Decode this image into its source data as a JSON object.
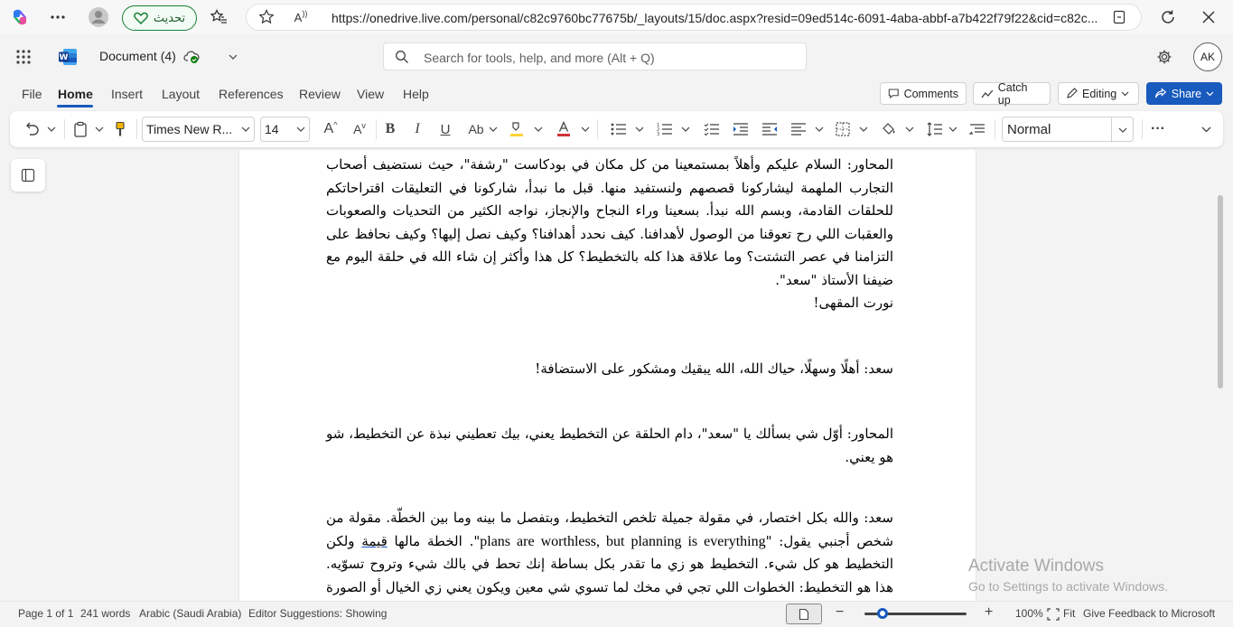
{
  "browser": {
    "update_button": "تحديث",
    "reader_label": "A",
    "url": "https://onedrive.live.com/personal/c82c9760bc77675b/_layouts/15/doc.aspx?resid=09ed514c-6091-4aba-abbf-a7b422f79f22&cid=c82c..."
  },
  "title_bar": {
    "doc_name": "Document (4)",
    "search_placeholder": "Search for tools, help, and more (Alt + Q)",
    "user_initials": "AK"
  },
  "tabs": [
    "File",
    "Home",
    "Insert",
    "Layout",
    "References",
    "Review",
    "View",
    "Help"
  ],
  "active_tab": "Home",
  "actions": {
    "comments": "Comments",
    "catch_up": "Catch up",
    "editing": "Editing",
    "share": "Share"
  },
  "ribbon": {
    "font_name": "Times New R...",
    "font_size": "14",
    "style": "Normal",
    "more": "···",
    "font_color": "#d13438",
    "highlight_color": "#ffd335"
  },
  "document": {
    "paragraphs": [
      "المحاور: السلام عليكم وأهلاً بمستمعينا من كل مكان في بودكاست \"رشفة\"، حيث نستضيف أصحاب التجارب الملهمة ليشاركونا قصصهم ولنستفيد منها. قبل ما نبدأ، شاركونا في التعليقات اقتراحاتكم للحلقات القادمة، وبسم الله نبدأ. بسعينا وراء النجاح والإنجاز، نواجه الكثير من التحديات والصعوبات والعقبات اللي رح تعوقنا من الوصول لأهدافنا. كيف نحدد أهدافنا؟ وكيف نصل إليها؟ وكيف نحافظ على التزامنا في عصر التشتت؟ وما علاقة هذا كله بالتخطيط؟ كل هذا وأكثر إن شاء الله في حلقة اليوم مع ضيفنا الأستاذ \"سعد\".",
      "نورت المقهى!",
      "سعد: أهلًا وسهلًا، حياك الله، الله يبقيك ومشكور على الاستضافة!",
      "المحاور: أوّل شي بسألك يا \"سعد\"، دام الحلقة عن التخطيط يعني، بيك تعطيني نبذة عن التخطيط، شو هو يعني."
    ],
    "p5_intro": "سعد: والله بكل اختصار، في مقولة جميلة تلخص التخطيط، وبتفصل ما بينه وما بين الخطّة. مقولة من شخص أجنبي يقول: \"",
    "p5_quote": "plans are worthless, but planning is everything",
    "p5_mid": "\". الخطة مالها ",
    "p5_underlined": "قيمة",
    "p5_rest": " ولكن التخطيط هو كل شيء. التخطيط هو زي ما تقدر بكل بساطة إنك تحط في بالك شيء وتروح تسوّيه. هذا هو التخطيط: الخطوات اللي تجي في مخك لما تسوي شي معين ويكون يعني زي الخيال أو الصورة اللي تشوف فيها الطريق. ولكن له علمه، وله قواعده، وله كتبه، ويعني موضوع قُتل بحثًا عن الصراحة وما زال، إلى أن"
  },
  "watermark": {
    "title": "Activate Windows",
    "subtitle": "Go to Settings to activate Windows."
  },
  "status_bar": {
    "page": "Page 1 of 1",
    "words": "241 words",
    "language": "Arabic (Saudi Arabia)",
    "editor": "Editor Suggestions: Showing",
    "zoom_out": "−",
    "zoom_in": "+",
    "zoom_level": "100%",
    "fit": "Fit",
    "feedback": "Give Feedback to Microsoft",
    "zoom_fraction": 0.18
  }
}
